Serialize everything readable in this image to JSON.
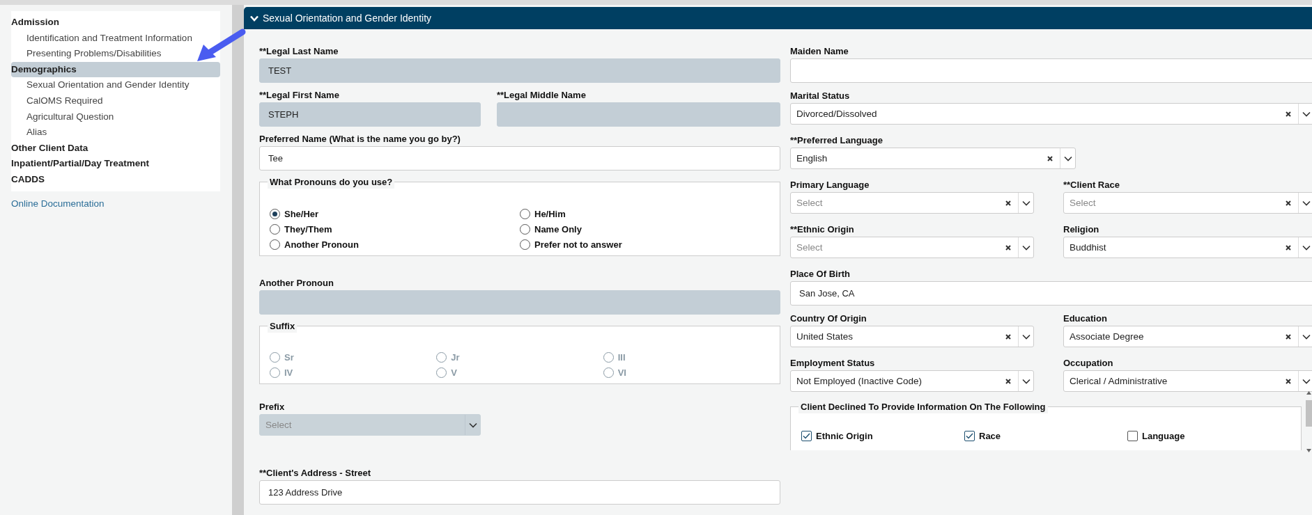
{
  "sidebar": {
    "items": [
      {
        "label": "Admission",
        "selected": false,
        "children": [
          {
            "label": "Identification and Treatment Information",
            "selected": false
          },
          {
            "label": "Presenting Problems/Disabilities",
            "selected": false
          }
        ]
      },
      {
        "label": "Demographics",
        "selected": true,
        "children": [
          {
            "label": "Sexual Orientation and Gender Identity",
            "selected": false
          },
          {
            "label": "CalOMS Required",
            "selected": false
          },
          {
            "label": "Agricultural Question",
            "selected": false
          },
          {
            "label": "Alias",
            "selected": false
          }
        ]
      },
      {
        "label": "Other Client Data",
        "selected": false
      },
      {
        "label": "Inpatient/Partial/Day Treatment",
        "selected": false
      },
      {
        "label": "CADDS",
        "selected": false
      }
    ],
    "link": "Online Documentation"
  },
  "section": {
    "title": "Sexual Orientation and Gender Identity",
    "expanded": true
  },
  "form": {
    "left_rows": [
      [
        {
          "kind": "text",
          "label": "**Legal Last Name",
          "value": "TEST",
          "disabled": true
        }
      ],
      [
        {
          "kind": "text",
          "label": "**Legal First Name",
          "value": "STEPH",
          "disabled": true
        },
        {
          "kind": "text",
          "label": "**Legal Middle Name",
          "disabled": true
        }
      ],
      [
        {
          "kind": "text",
          "label": "Preferred Name (What is the name you go by?)",
          "value": "Tee",
          "disabled": false
        }
      ],
      [
        {
          "kind": "radios",
          "label": "What Pronouns do you use?",
          "disabled": false,
          "options": [
            {
              "label": "She/Her",
              "selected": true
            },
            {
              "label": "He/Him",
              "selected": false
            },
            {
              "label": "They/Them",
              "selected": false
            },
            {
              "label": "Name Only",
              "selected": false
            },
            {
              "label": "Another Pronoun",
              "selected": false
            },
            {
              "label": "Prefer not to answer",
              "selected": false
            }
          ]
        }
      ],
      [
        {
          "kind": "text",
          "label": "Another Pronoun",
          "disabled": true
        }
      ],
      [
        {
          "kind": "radios",
          "label": "Suffix",
          "disabled": true,
          "options": [
            {
              "label": "Sr",
              "selected": false
            },
            {
              "label": "Jr",
              "selected": false
            },
            {
              "label": "III",
              "selected": false
            },
            {
              "label": "IV",
              "selected": false
            },
            {
              "label": "V",
              "selected": false
            },
            {
              "label": "VI",
              "selected": false
            }
          ]
        }
      ],
      [
        {
          "kind": "select",
          "label": "Prefix",
          "placeholder": "Select",
          "clearable": false,
          "disabled": true
        }
      ],
      [
        {
          "kind": "text",
          "label": "**Client's Address - Street",
          "value": "123 Address Drive",
          "disabled": false
        }
      ]
    ],
    "right_rows": [
      [
        {
          "kind": "text",
          "label": "Maiden Name",
          "disabled": false
        }
      ],
      [
        {
          "kind": "select",
          "label": "Marital Status",
          "value": "Divorced/Dissolved",
          "clearable": true,
          "disabled": false
        }
      ],
      [
        {
          "kind": "select",
          "label": "**Preferred Language",
          "value": "English",
          "clearable": true,
          "disabled": false
        }
      ],
      [
        {
          "kind": "select",
          "label": "Primary Language",
          "placeholder": "Select",
          "clearable": true,
          "disabled": false
        },
        {
          "kind": "select",
          "label": "**Client Race",
          "placeholder": "Select",
          "clearable": true,
          "disabled": false
        }
      ],
      [
        {
          "kind": "select",
          "label": "**Ethnic Origin",
          "placeholder": "Select",
          "clearable": true,
          "disabled": false
        },
        {
          "kind": "select",
          "label": "Religion",
          "value": "Buddhist",
          "clearable": true,
          "disabled": false
        }
      ],
      [
        {
          "kind": "text",
          "label": "Place Of Birth",
          "value": "San Jose, CA",
          "disabled": false
        }
      ],
      [
        {
          "kind": "select",
          "label": "Country Of Origin",
          "value": "United States",
          "clearable": true,
          "disabled": false
        },
        {
          "kind": "select",
          "label": "Education",
          "value": "Associate Degree",
          "clearable": true,
          "disabled": false
        }
      ],
      [
        {
          "kind": "select",
          "label": "Employment Status",
          "value": "Not Employed (Inactive Code)",
          "clearable": true,
          "disabled": false
        },
        {
          "kind": "select",
          "label": "Occupation",
          "value": "Clerical / Administrative",
          "clearable": true,
          "disabled": false
        }
      ],
      [
        {
          "kind": "checks",
          "label": "Client Declined To Provide Information On The Following",
          "options": [
            {
              "label": "Ethnic Origin",
              "checked": true
            },
            {
              "label": "Race",
              "checked": true
            },
            {
              "label": "Language",
              "checked": false
            }
          ]
        }
      ]
    ]
  }
}
